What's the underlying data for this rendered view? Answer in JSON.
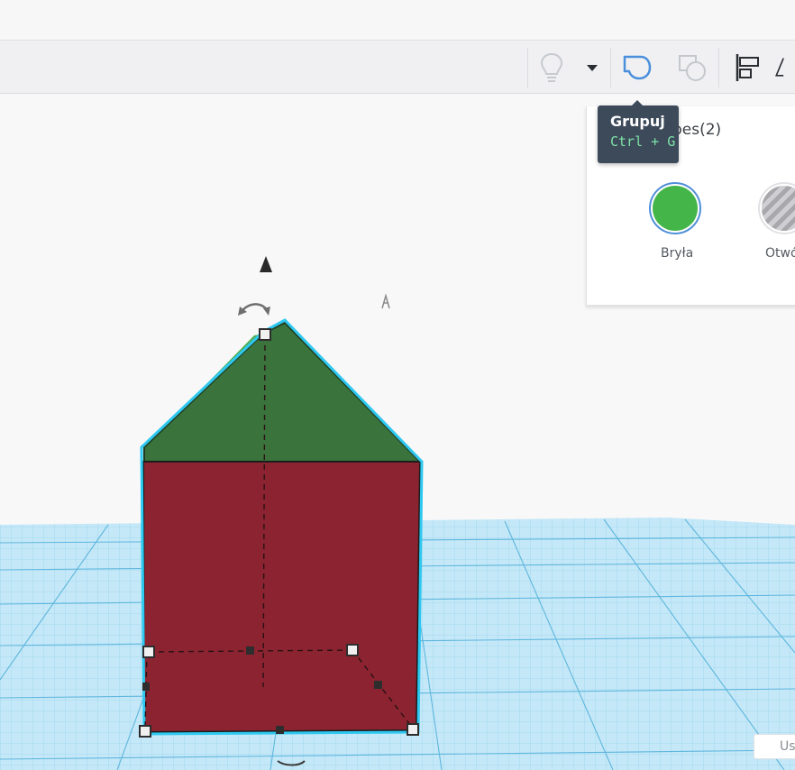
{
  "toolbar": {
    "hint_icon": "lightbulb-icon",
    "dropdown_icon": "caret-down-icon",
    "group_icon": "group-icon",
    "ungroup_icon": "ungroup-icon",
    "align_icon": "align-icon",
    "mirror_icon": "mirror-icon"
  },
  "tooltip": {
    "title": "Grupuj",
    "shortcut": "Ctrl + G"
  },
  "inspector": {
    "title": "Shapes(2)",
    "solid_label": "Bryła",
    "hole_label": "Otwó",
    "solid_color": "#44b649"
  },
  "scene": {
    "roof_color": "#3a743c",
    "body_color": "#8b2430",
    "selection_color": "#2ec8f0",
    "grid_color": "#8fd0ec"
  },
  "corner": {
    "label": "Us"
  }
}
